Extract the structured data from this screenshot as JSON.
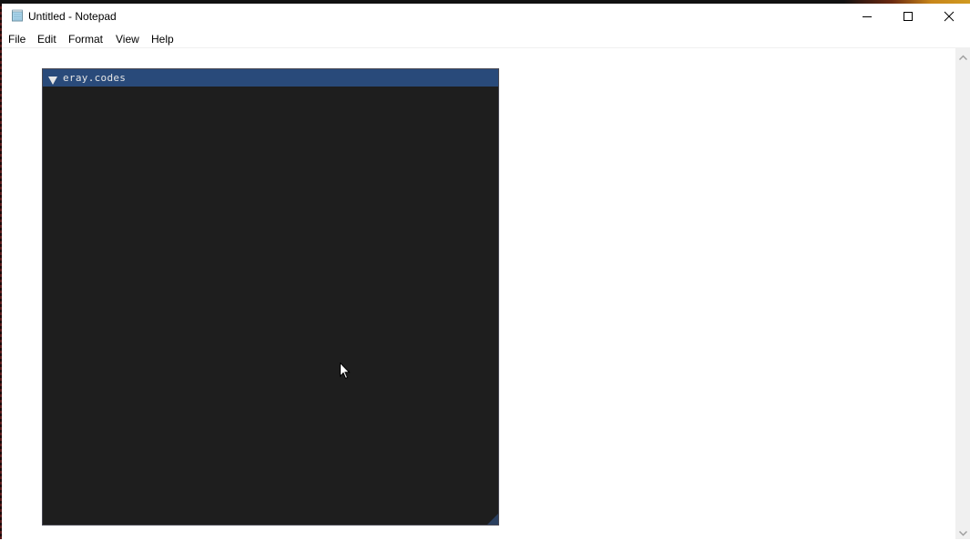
{
  "window": {
    "title": "Untitled - Notepad",
    "app_icon": "notepad-icon",
    "controls": {
      "minimize": "minimize-icon",
      "maximize": "maximize-icon",
      "close": "close-icon"
    }
  },
  "menu": {
    "items": [
      {
        "label": "File"
      },
      {
        "label": "Edit"
      },
      {
        "label": "Format"
      },
      {
        "label": "View"
      },
      {
        "label": "Help"
      }
    ]
  },
  "editor": {
    "content": ""
  },
  "overlay": {
    "title": "eray.codes",
    "collapse_icon": "triangle-down-icon",
    "colors": {
      "title_bg": "#294a7a",
      "body_bg": "#1e1e1e"
    }
  },
  "scrollbar": {
    "up_icon": "chevron-up-icon",
    "down_icon": "chevron-down-icon"
  }
}
